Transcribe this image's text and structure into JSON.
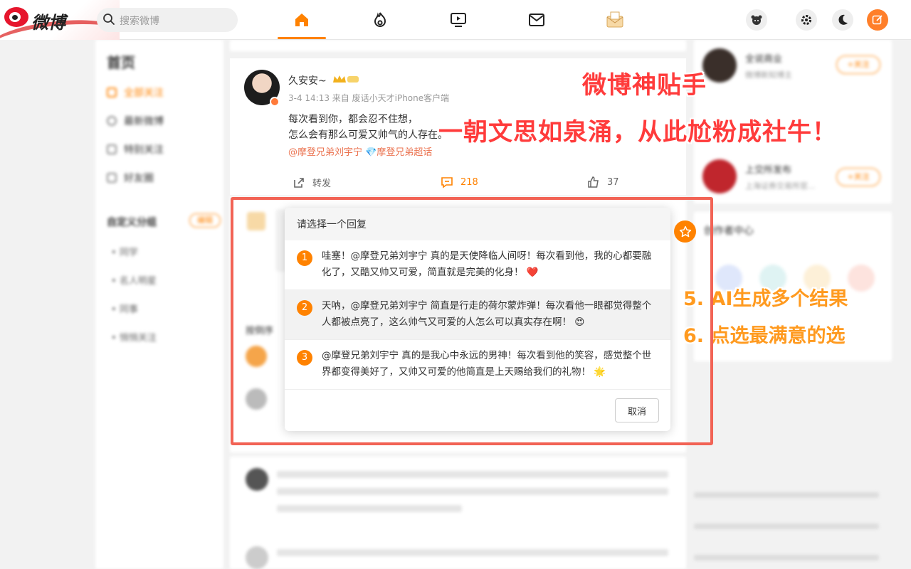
{
  "header": {
    "logo_text": "微博",
    "search_placeholder": "搜索微博",
    "nav": [
      "home-icon",
      "hot-icon",
      "video-icon",
      "message-icon",
      "envelope-ai-icon"
    ],
    "active_nav": "home-icon",
    "right_icons": [
      "game-icon",
      "settings-icon",
      "dark-mode-icon",
      "compose-icon"
    ]
  },
  "sidebar": {
    "title": "首页",
    "items": [
      {
        "label": "全部关注",
        "active": true
      },
      {
        "label": "最新微博"
      },
      {
        "label": "特别关注"
      },
      {
        "label": "好友圈"
      }
    ],
    "group_title": "自定义分组",
    "group_edit": "编辑",
    "groups": [
      "同学",
      "名人明星",
      "同事",
      "悄悄关注"
    ]
  },
  "post": {
    "username": "久安安~",
    "meta": "3-4 14:13  来自 废话小天才iPhone客户端",
    "text_lines": [
      "每次看到你，都会忍不住想，",
      "怎么会有那么可爱又帅气的人存在。"
    ],
    "tags": "@摩登兄弟刘宇宁 💎摩登兄弟超话",
    "repost_label": "转发",
    "comment_count": "218",
    "like_count": "37"
  },
  "comments": {
    "sort_label": "按倒序"
  },
  "right_column": {
    "recommend": [
      {
        "name": "全说商业",
        "desc": "微博新知博主",
        "follow": "+关注"
      },
      {
        "name": "上交所发布",
        "desc": "上海证券交易所官...",
        "follow": "+关注"
      }
    ],
    "creator_center": "创作者中心"
  },
  "modal": {
    "title": "请选择一个回复",
    "options": [
      {
        "num": "1",
        "text": "哇塞！@摩登兄弟刘宇宁 真的是天使降临人间呀！每次看到他，我的心都要融化了，又酷又帅又可爱，简直就是完美的化身！",
        "emoji": "❤️"
      },
      {
        "num": "2",
        "text": "天呐，@摩登兄弟刘宇宁 简直是行走的荷尔蒙炸弹！每次看他一眼都觉得整个人都被点亮了，这么帅气又可爱的人怎么可以真实存在啊！",
        "emoji": "😍"
      },
      {
        "num": "3",
        "text": "@摩登兄弟刘宇宁 真的是我心中永远的男神！每次看到他的笑容，感觉整个世界都变得美好了，又帅又可爱的他简直是上天赐给我们的礼物！",
        "emoji": "🌟"
      }
    ],
    "hover_index": 1,
    "cancel_label": "取消"
  },
  "overlay": {
    "title": "微博神贴手",
    "subtitle": "一朝文思如泉涌，从此尬粉成社牛！",
    "step5": "5. AI生成多个结果",
    "step6": "6. 点选最满意的选"
  },
  "colors": {
    "accent": "#ff8200",
    "highlight_red": "#f26355",
    "promo_red": "#ff3b3b",
    "step_orange": "#ff9a1f"
  }
}
